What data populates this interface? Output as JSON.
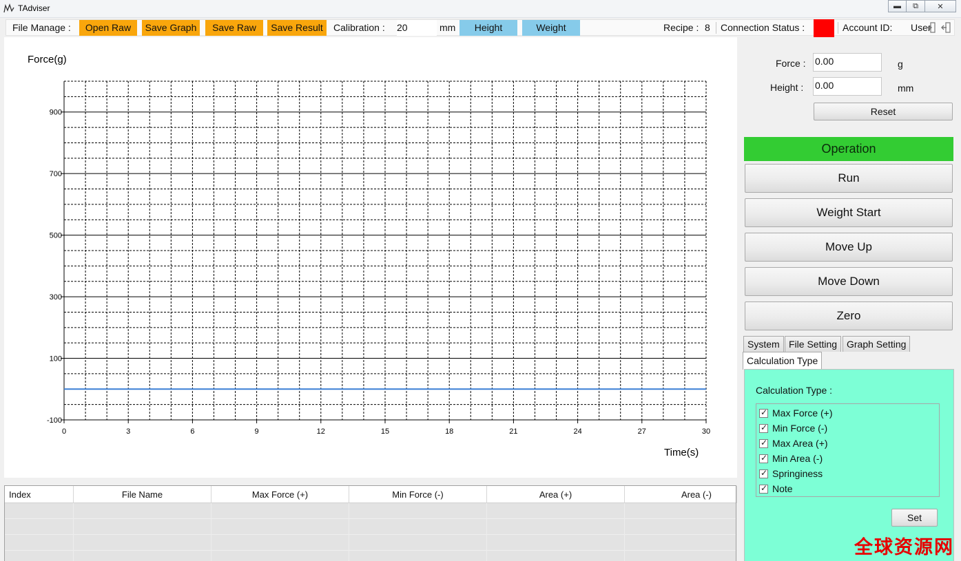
{
  "window": {
    "title": "TAdviser"
  },
  "toolbar": {
    "file_manage_label": "File Manage :",
    "open_raw": "Open Raw",
    "save_graph": "Save Graph",
    "save_raw": "Save Raw",
    "save_result": "Save Result",
    "calibration_label": "Calibration :",
    "calibration_value": "20",
    "calibration_unit": "mm",
    "height_btn": "Height",
    "weight_btn": "Weight",
    "recipe_label": "Recipe :",
    "recipe_value": "8",
    "connection_label": "Connection Status :",
    "connection_color": "#ff0000",
    "account_label": "Account ID:",
    "account_value": "User"
  },
  "readout": {
    "force_label": "Force :",
    "force_value": "0.00",
    "force_unit": "g",
    "height_label": "Height :",
    "height_value": "0.00",
    "height_unit": "mm",
    "reset": "Reset"
  },
  "operation": {
    "header": "Operation",
    "header_color": "#33cc33",
    "run": "Run",
    "weight_start": "Weight Start",
    "move_up": "Move Up",
    "move_down": "Move Down",
    "zero": "Zero"
  },
  "tabs": [
    {
      "label": "System"
    },
    {
      "label": "File Setting"
    },
    {
      "label": "Graph Setting"
    },
    {
      "label": "Calculation Type"
    }
  ],
  "calc": {
    "title": "Calculation Type :",
    "items": [
      {
        "label": "Max Force (+)",
        "checked": true
      },
      {
        "label": "Min Force (-)",
        "checked": true
      },
      {
        "label": "Max Area (+)",
        "checked": true
      },
      {
        "label": "Min Area (-)",
        "checked": true
      },
      {
        "label": "Springiness",
        "checked": true
      },
      {
        "label": "Note",
        "checked": true
      }
    ],
    "set": "Set",
    "panel_color": "#7dffd6"
  },
  "table": {
    "headers": [
      "Index",
      "File Name",
      "Max Force (+)",
      "Min Force (-)",
      "Area (+)",
      "Area (-)"
    ]
  },
  "chart_data": {
    "type": "line",
    "ylabel": "Force(g)",
    "xlabel": "Time(s)",
    "xlim": [
      0,
      30
    ],
    "ylim": [
      -100,
      1000
    ],
    "x_ticks": [
      0,
      3,
      6,
      9,
      12,
      15,
      18,
      21,
      24,
      27,
      30
    ],
    "y_ticks": [
      -100,
      100,
      300,
      500,
      700,
      900
    ],
    "grid": true,
    "series": [
      {
        "color": "#3a7fd5",
        "x": [
          0,
          30
        ],
        "y": [
          0,
          0
        ]
      }
    ]
  },
  "watermark": "全球资源网"
}
